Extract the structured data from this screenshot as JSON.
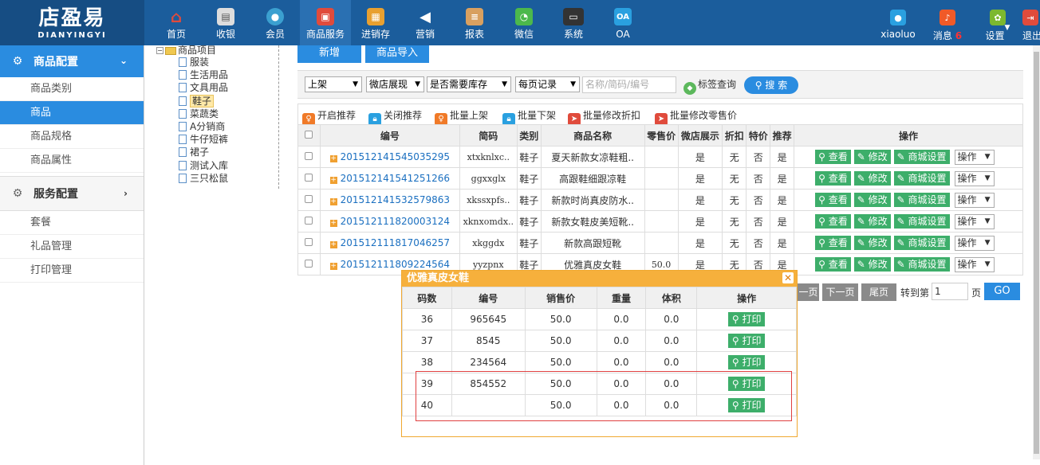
{
  "logo": {
    "line1": "店盈易",
    "line2": "DIANYINGYI"
  },
  "nav": [
    {
      "label": "首页",
      "icon": "home-icon",
      "color": "#e04b3c"
    },
    {
      "label": "收银",
      "icon": "cash-register-icon",
      "color": "#777777"
    },
    {
      "label": "会员",
      "icon": "member-icon",
      "color": "#3ba0d0"
    },
    {
      "label": "商品服务",
      "icon": "goods-service-icon",
      "color": "#e04b3c"
    },
    {
      "label": "进销存",
      "icon": "inventory-icon",
      "color": "#e8a030"
    },
    {
      "label": "营销",
      "icon": "marketing-icon",
      "color": "#ffffff"
    },
    {
      "label": "报表",
      "icon": "report-icon",
      "color": "#d8a060"
    },
    {
      "label": "微信",
      "icon": "wechat-icon",
      "color": "#4cb84c"
    },
    {
      "label": "系统",
      "icon": "system-icon",
      "color": "#333333"
    },
    {
      "label": "OA",
      "icon": "oa-icon",
      "color": "#2aa0e0"
    }
  ],
  "user": {
    "name": "xiaoluo",
    "messages_label": "消息",
    "messages_count": "6",
    "settings_label": "设置",
    "logout_label": "退出"
  },
  "sidebar": {
    "section1": "商品配置",
    "section1_items": [
      "商品类别",
      "商品",
      "商品规格",
      "商品属性"
    ],
    "section2": "服务配置",
    "section2_items": [
      "套餐",
      "礼品管理",
      "打印管理"
    ]
  },
  "tree": {
    "root": "商品项目",
    "nodes": [
      "服装",
      "生活用品",
      "文具用品",
      "鞋子",
      "菜蔬类",
      "A分销商",
      "牛仔短裤",
      "裙子",
      "测试入库",
      "三只松鼠"
    ]
  },
  "buttons": {
    "add": "新增",
    "import": "商品导入"
  },
  "filter": {
    "shelf": "上架",
    "micro_display": "微店展现",
    "need_stock": "是否需要库存",
    "per_page": "每页记录",
    "search_placeholder": "名称/简码/编号",
    "tag_query": "标签查询",
    "search": "搜 索"
  },
  "actions": [
    "开启推荐",
    "关闭推荐",
    "批量上架",
    "批量下架",
    "批量修改折扣",
    "批量修改零售价"
  ],
  "table": {
    "headers": [
      "编号",
      "简码",
      "类别",
      "商品名称",
      "零售价",
      "微店展示",
      "折扣",
      "特价",
      "推荐",
      "操作"
    ],
    "view": "查看",
    "edit": "修改",
    "mall": "商城设置",
    "op": "操作",
    "rows": [
      {
        "code": "201512141545035295",
        "short": "xtxknlxc..",
        "cat": "鞋子",
        "name": "夏天新款女凉鞋粗..",
        "price": "",
        "show": "是",
        "disc": "无",
        "special": "否",
        "rec": "是"
      },
      {
        "code": "201512141541251266",
        "short": "ggxxglx",
        "cat": "鞋子",
        "name": "高跟鞋细跟凉鞋",
        "price": "",
        "show": "是",
        "disc": "无",
        "special": "否",
        "rec": "是"
      },
      {
        "code": "201512141532579863",
        "short": "xkssxpfs..",
        "cat": "鞋子",
        "name": "新款时尚真皮防水..",
        "price": "",
        "show": "是",
        "disc": "无",
        "special": "否",
        "rec": "是"
      },
      {
        "code": "201512111820003124",
        "short": "xknxomdx..",
        "cat": "鞋子",
        "name": "新款女鞋皮美短靴..",
        "price": "",
        "show": "是",
        "disc": "无",
        "special": "否",
        "rec": "是"
      },
      {
        "code": "201512111817046257",
        "short": "xkggdx",
        "cat": "鞋子",
        "name": "新款高跟短靴",
        "price": "",
        "show": "是",
        "disc": "无",
        "special": "否",
        "rec": "是"
      },
      {
        "code": "201512111809224564",
        "short": "yyzpnx",
        "cat": "鞋子",
        "name": "优雅真皮女鞋",
        "price": "50.0",
        "show": "是",
        "disc": "无",
        "special": "否",
        "rec": "是"
      }
    ]
  },
  "pager": {
    "prev_partial": "一页",
    "next": "下一页",
    "last": "尾页",
    "goto": "转到第",
    "page_value": "1",
    "page_unit": "页",
    "go": "GO"
  },
  "dialog": {
    "title": "优雅真皮女鞋",
    "headers": [
      "码数",
      "编号",
      "销售价",
      "重量",
      "体积",
      "操作"
    ],
    "print": "打印",
    "rows": [
      {
        "size": "36",
        "code": "965645",
        "price": "50.0",
        "weight": "0.0",
        "volume": "0.0"
      },
      {
        "size": "37",
        "code": "8545",
        "price": "50.0",
        "weight": "0.0",
        "volume": "0.0"
      },
      {
        "size": "38",
        "code": "234564",
        "price": "50.0",
        "weight": "0.0",
        "volume": "0.0"
      },
      {
        "size": "39",
        "code": "854552",
        "price": "50.0",
        "weight": "0.0",
        "volume": "0.0"
      },
      {
        "size": "40",
        "code": "",
        "price": "50.0",
        "weight": "0.0",
        "volume": "0.0"
      }
    ]
  }
}
